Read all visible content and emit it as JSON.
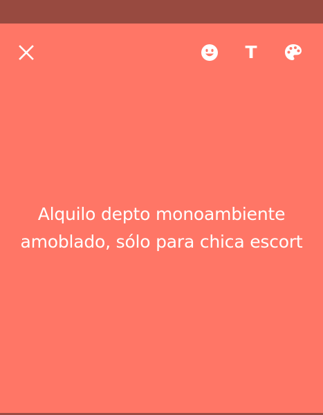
{
  "colors": {
    "background": "#ff7666",
    "status_bar": "#984a40",
    "text": "#ffffff"
  },
  "toolbar": {
    "close_icon": "close-icon",
    "emoji_icon": "emoji-icon",
    "text_tool_label": "T",
    "palette_icon": "palette-icon"
  },
  "post": {
    "text": "Alquilo depto monoambiente amoblado, sólo para chica escort"
  }
}
